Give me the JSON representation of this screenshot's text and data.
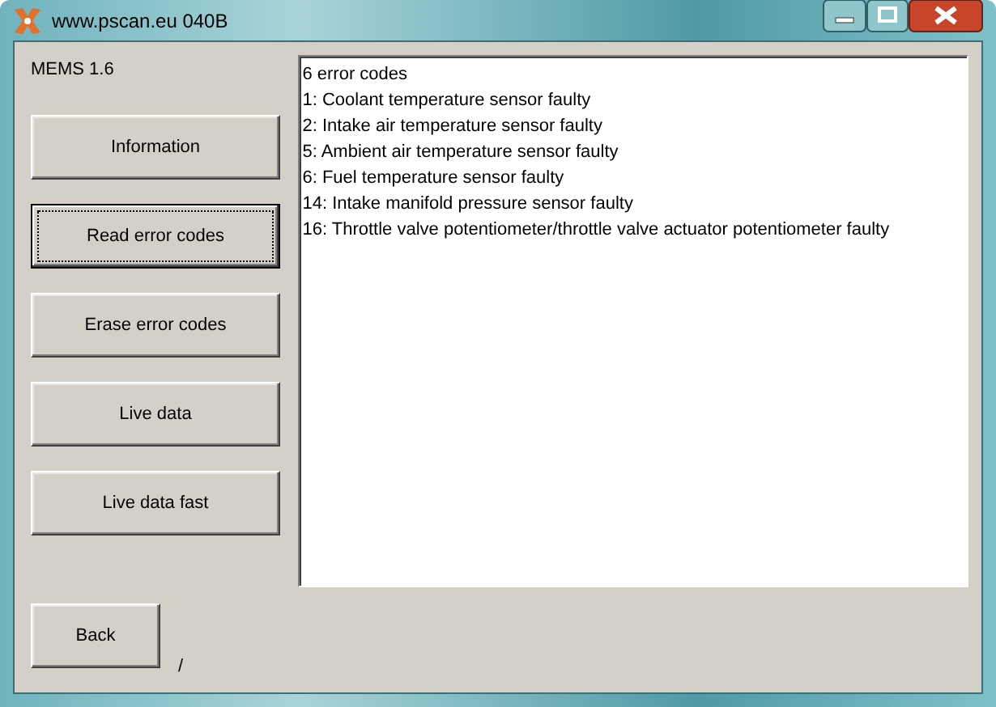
{
  "window": {
    "title": "www.pscan.eu 040B"
  },
  "version_label": "MEMS 1.6",
  "buttons": [
    {
      "label": "Information",
      "focused": false
    },
    {
      "label": "Read error codes",
      "focused": true
    },
    {
      "label": "Erase error codes",
      "focused": false
    },
    {
      "label": "Live data",
      "focused": false
    },
    {
      "label": "Live data fast",
      "focused": false
    }
  ],
  "output_lines": [
    "6 error codes",
    "1: Coolant temperature sensor faulty",
    "2: Intake air temperature sensor faulty",
    "5: Ambient air temperature sensor faulty",
    "6: Fuel temperature sensor faulty",
    "14: Intake manifold pressure sensor faulty",
    "16: Throttle valve potentiometer/throttle valve actuator potentiometer faulty"
  ],
  "back_button": {
    "label": "Back",
    "focused": false
  },
  "status_text": "/"
}
